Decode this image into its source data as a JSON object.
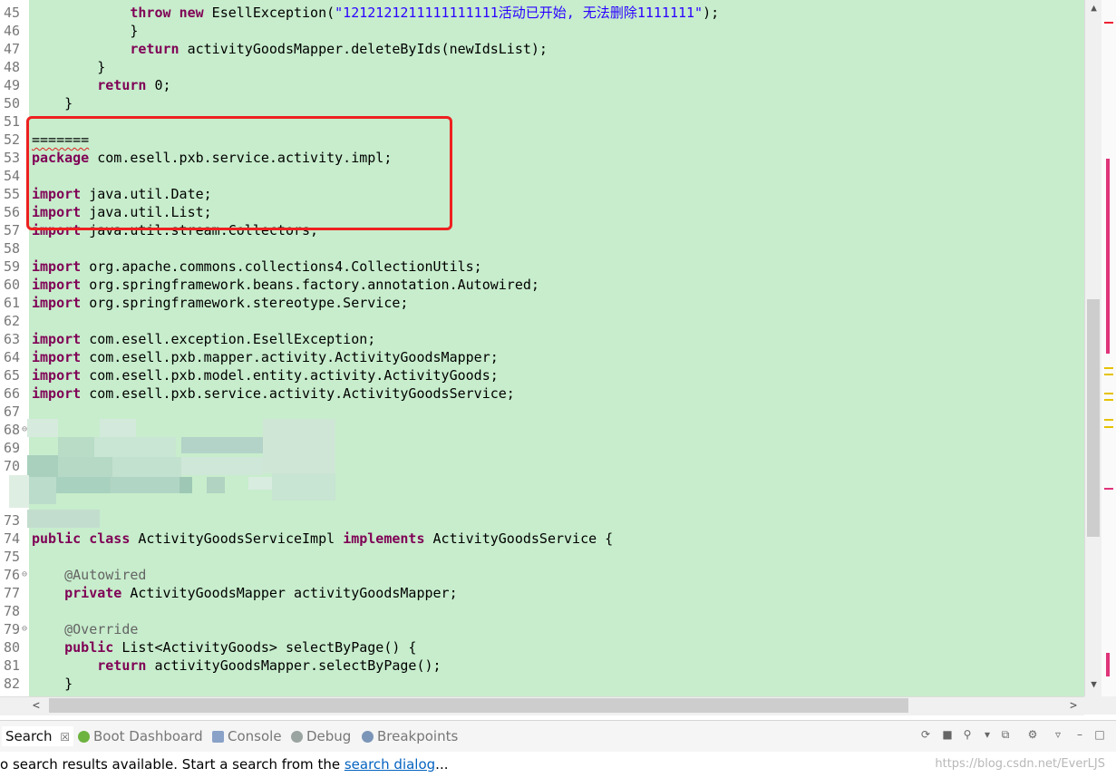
{
  "editor": {
    "lines": [
      {
        "n": "45",
        "segs": [
          {
            "t": "            ",
            "c": ""
          },
          {
            "t": "throw",
            "c": "kw"
          },
          {
            "t": " ",
            "c": ""
          },
          {
            "t": "new",
            "c": "kw"
          },
          {
            "t": " EsellException(",
            "c": ""
          },
          {
            "t": "\"1212121211111111111活动已开始, 无法删除1111111\"",
            "c": "str"
          },
          {
            "t": ");",
            "c": ""
          }
        ]
      },
      {
        "n": "46",
        "segs": [
          {
            "t": "            }",
            "c": ""
          }
        ]
      },
      {
        "n": "47",
        "segs": [
          {
            "t": "            ",
            "c": ""
          },
          {
            "t": "return",
            "c": "kw"
          },
          {
            "t": " activityGoodsMapper.deleteByIds(newIdsList);",
            "c": ""
          }
        ]
      },
      {
        "n": "48",
        "segs": [
          {
            "t": "        }",
            "c": ""
          }
        ]
      },
      {
        "n": "49",
        "segs": [
          {
            "t": "        ",
            "c": ""
          },
          {
            "t": "return",
            "c": "kw"
          },
          {
            "t": " 0;",
            "c": ""
          }
        ]
      },
      {
        "n": "50",
        "segs": [
          {
            "t": "    }",
            "c": ""
          }
        ]
      },
      {
        "n": "51",
        "segs": []
      },
      {
        "n": "52",
        "segs": [
          {
            "t": "=======",
            "c": "squig"
          }
        ]
      },
      {
        "n": "53",
        "segs": [
          {
            "t": "package",
            "c": "kw"
          },
          {
            "t": " com.esell.pxb.service.activity.impl;",
            "c": ""
          }
        ]
      },
      {
        "n": "54",
        "segs": []
      },
      {
        "n": "55",
        "segs": [
          {
            "t": "import",
            "c": "kw"
          },
          {
            "t": " java.util.Date;",
            "c": ""
          }
        ]
      },
      {
        "n": "56",
        "segs": [
          {
            "t": "import",
            "c": "kw"
          },
          {
            "t": " java.util.List;",
            "c": ""
          }
        ]
      },
      {
        "n": "57",
        "segs": [
          {
            "t": "import",
            "c": "kw"
          },
          {
            "t": " java.util.stream.Collectors;",
            "c": ""
          }
        ]
      },
      {
        "n": "58",
        "segs": []
      },
      {
        "n": "59",
        "segs": [
          {
            "t": "import",
            "c": "kw"
          },
          {
            "t": " org.apache.commons.collections4.CollectionUtils;",
            "c": ""
          }
        ]
      },
      {
        "n": "60",
        "segs": [
          {
            "t": "import",
            "c": "kw"
          },
          {
            "t": " org.springframework.beans.factory.annotation.Autowired;",
            "c": ""
          }
        ]
      },
      {
        "n": "61",
        "segs": [
          {
            "t": "import",
            "c": "kw"
          },
          {
            "t": " org.springframework.stereotype.Service;",
            "c": ""
          }
        ]
      },
      {
        "n": "62",
        "segs": []
      },
      {
        "n": "63",
        "segs": [
          {
            "t": "import",
            "c": "kw"
          },
          {
            "t": " com.esell.exception.EsellException;",
            "c": ""
          }
        ]
      },
      {
        "n": "64",
        "segs": [
          {
            "t": "import",
            "c": "kw"
          },
          {
            "t": " com.esell.pxb.mapper.activity.ActivityGoodsMapper;",
            "c": ""
          }
        ]
      },
      {
        "n": "65",
        "segs": [
          {
            "t": "import",
            "c": "kw"
          },
          {
            "t": " com.esell.pxb.model.entity.activity.ActivityGoods;",
            "c": ""
          }
        ]
      },
      {
        "n": "66",
        "segs": [
          {
            "t": "import",
            "c": "kw"
          },
          {
            "t": " com.esell.pxb.service.activity.ActivityGoodsService;",
            "c": ""
          }
        ]
      },
      {
        "n": "67",
        "segs": []
      },
      {
        "n": "68",
        "segs": []
      },
      {
        "n": "69",
        "segs": []
      },
      {
        "n": "70",
        "segs": []
      },
      {
        "n": "",
        "segs": []
      },
      {
        "n": "",
        "segs": []
      },
      {
        "n": "73",
        "segs": []
      },
      {
        "n": "74",
        "segs": [
          {
            "t": "public",
            "c": "kw"
          },
          {
            "t": " ",
            "c": ""
          },
          {
            "t": "class",
            "c": "kw"
          },
          {
            "t": " ActivityGoodsServiceImpl ",
            "c": ""
          },
          {
            "t": "implements",
            "c": "kw"
          },
          {
            "t": " ActivityGoodsService {",
            "c": ""
          }
        ]
      },
      {
        "n": "75",
        "segs": []
      },
      {
        "n": "76",
        "segs": [
          {
            "t": "    @Autowired",
            "c": "ann"
          }
        ]
      },
      {
        "n": "77",
        "segs": [
          {
            "t": "    ",
            "c": ""
          },
          {
            "t": "private",
            "c": "kw"
          },
          {
            "t": " ActivityGoodsMapper activityGoodsMapper;",
            "c": ""
          }
        ]
      },
      {
        "n": "78",
        "segs": []
      },
      {
        "n": "79",
        "segs": [
          {
            "t": "    @Override",
            "c": "ann"
          }
        ]
      },
      {
        "n": "80",
        "segs": [
          {
            "t": "    ",
            "c": ""
          },
          {
            "t": "public",
            "c": "kw"
          },
          {
            "t": " List<ActivityGoods> selectByPage() {",
            "c": ""
          }
        ]
      },
      {
        "n": "81",
        "segs": [
          {
            "t": "        ",
            "c": ""
          },
          {
            "t": "return",
            "c": "kw"
          },
          {
            "t": " activityGoodsMapper.selectByPage();",
            "c": ""
          }
        ]
      },
      {
        "n": "82",
        "segs": [
          {
            "t": "    }",
            "c": ""
          }
        ]
      }
    ]
  },
  "panel": {
    "tabs": [
      {
        "label": "Search",
        "icon": "search-icon",
        "active": true,
        "close": "☒"
      },
      {
        "label": "Boot Dashboard",
        "icon": "boot-dashboard-icon",
        "active": false
      },
      {
        "label": "Console",
        "icon": "console-icon",
        "active": false
      },
      {
        "label": "Debug",
        "icon": "debug-icon",
        "active": false
      },
      {
        "label": "Breakpoints",
        "icon": "breakpoints-icon",
        "active": false
      }
    ]
  },
  "status": {
    "prefix": "o search results available. Start a search from the ",
    "link": "search dialog",
    "suffix": "..."
  },
  "watermark": "https://blog.csdn.net/EverLJS",
  "colors": {
    "editor_bg": "#c7edcc",
    "keyword": "#7f0055",
    "string": "#2a00ff",
    "highlight_box": "#ee2020"
  }
}
